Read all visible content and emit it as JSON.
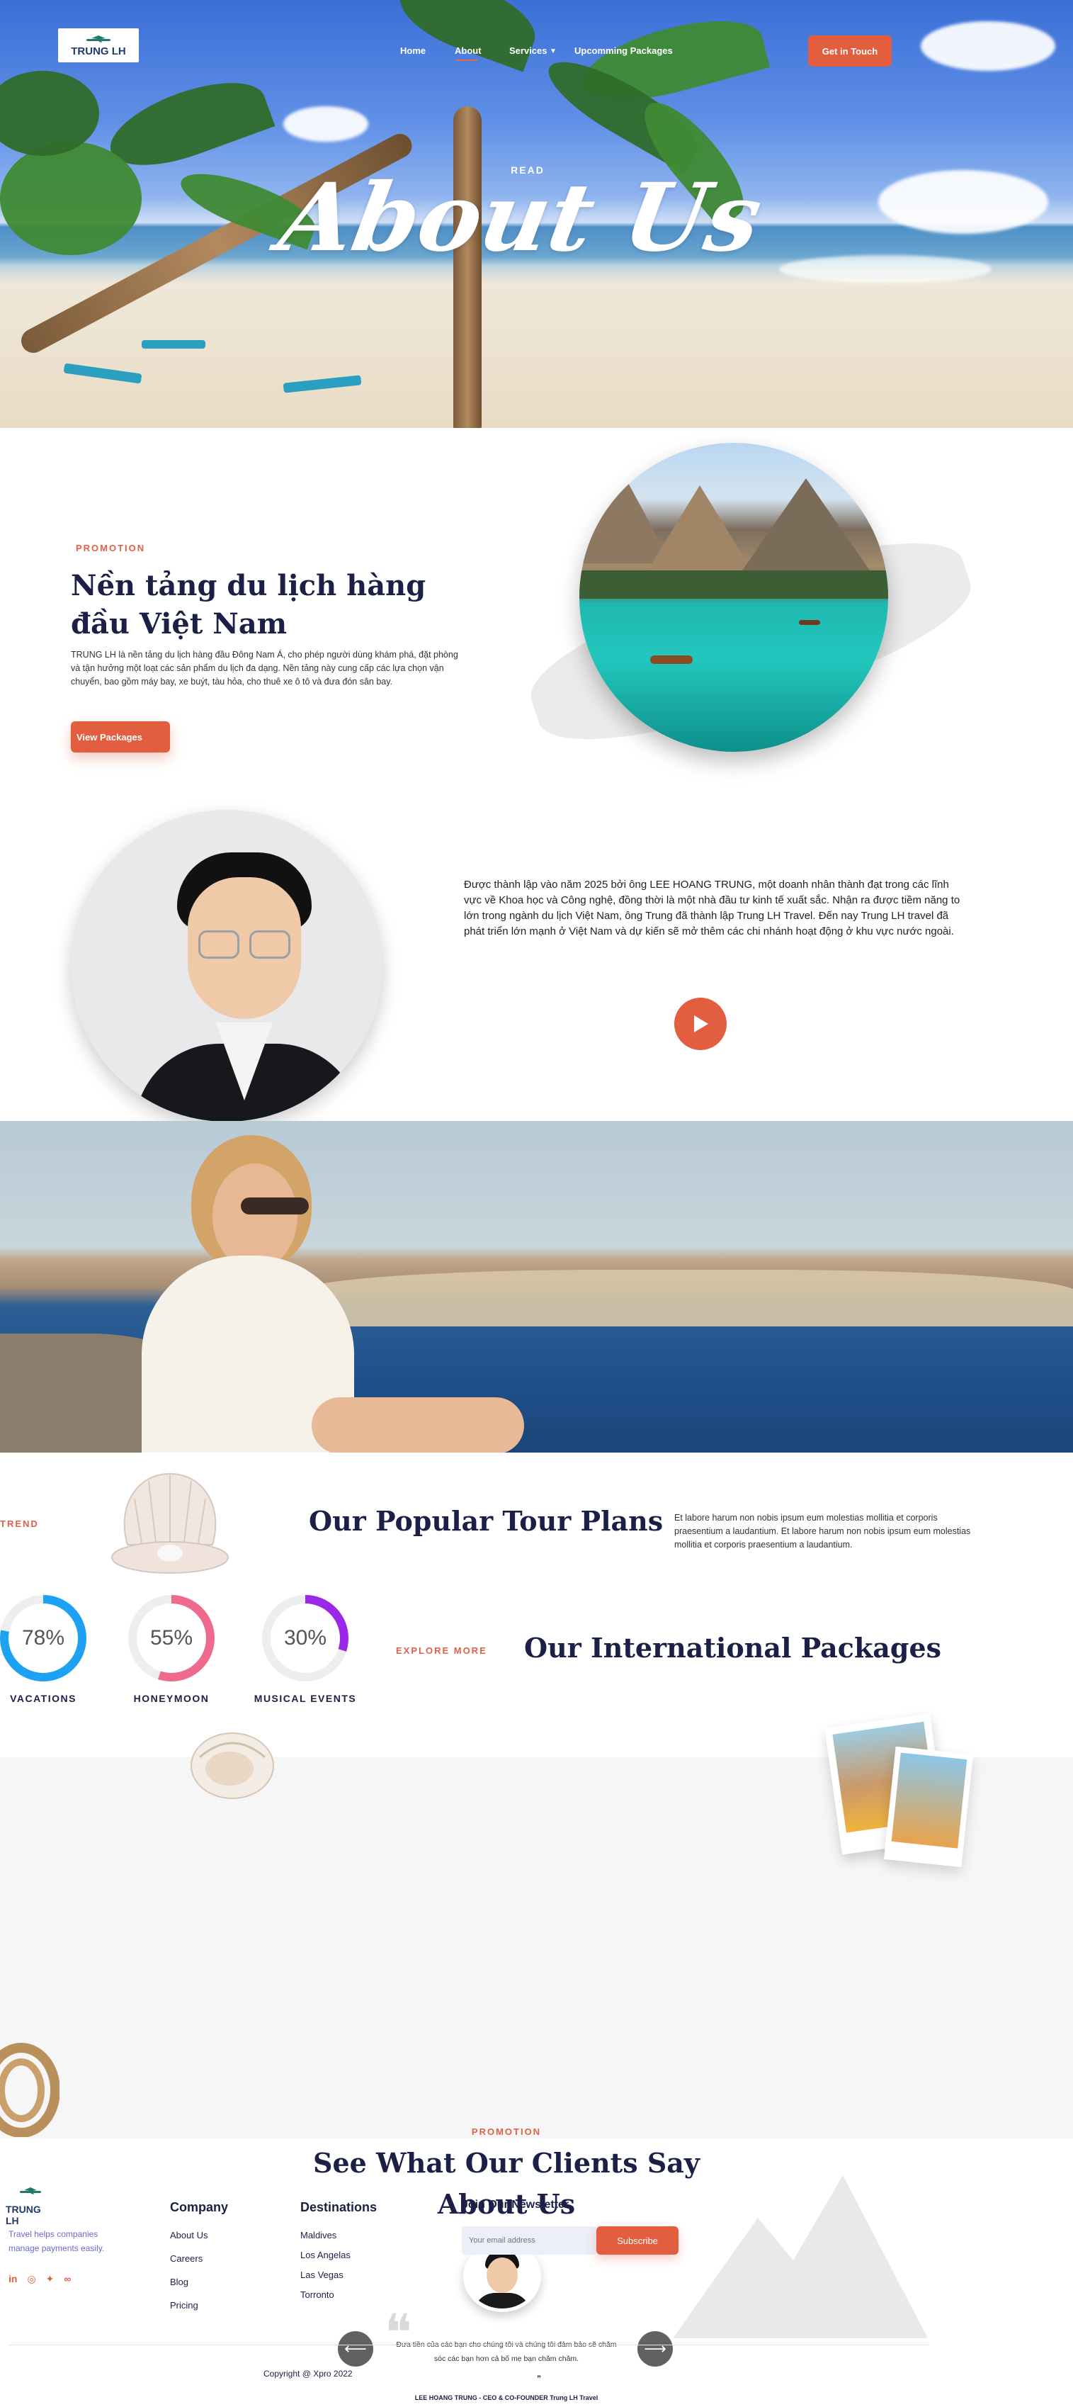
{
  "brand": {
    "name": "TRUNG LH",
    "accent": "#e35d3f",
    "navy": "#1c2046"
  },
  "nav": {
    "items": [
      "Home",
      "About",
      "Services",
      "Upcomming Packages"
    ],
    "active": "About",
    "cta": "Get in Touch"
  },
  "hero": {
    "eyebrow": "READ",
    "title": "About Us"
  },
  "promotion": {
    "eyebrow": "PROMOTION",
    "title_line1": "Nền tảng du lịch hàng",
    "title_line2": "đầu Việt Nam",
    "body": "TRUNG LH là nền tảng du lịch hàng đầu Đông Nam Á, cho phép người dùng khám phá, đặt phòng và tận hưởng một loạt các sản phẩm du lịch đa dạng. Nền tảng này cung cấp các lựa chọn vận chuyển, bao gồm máy bay, xe buýt, tàu hỏa, cho thuê xe ô tô và đưa đón sân bay.",
    "button": "View Packages"
  },
  "founder": {
    "text": "Được thành lập vào năm 2025 bởi ông LEE HOANG TRUNG, một doanh nhân thành đạt trong các lĩnh vực về Khoa học và Công nghệ, đồng thời là một nhà đầu tư kinh tế xuất sắc. Nhận ra được tiềm năng to lớn trong ngành du lịch Việt Nam, ông Trung đã thành lập Trung LH Travel. Đến nay Trung LH travel đã phát triển lớn mạnh ở Việt Nam và dự kiến sẽ mở thêm các chi nhánh hoạt động ở khu vực nước ngoài."
  },
  "tours": {
    "eyebrow": "TREND",
    "title": "Our Popular Tour Plans",
    "body": "Et labore harum non nobis ipsum eum molestias mollitia et corporis praesentium a laudantium. Et labore harum non nobis ipsum eum molestias mollitia et corporis praesentium a laudantium.",
    "stats": [
      {
        "label": "VACATIONS",
        "percent": 78,
        "display": "78%",
        "color": "#1da1f2"
      },
      {
        "label": "HONEYMOON",
        "percent": 55,
        "display": "55%",
        "color": "#f06a8e"
      },
      {
        "label": "MUSICAL EVENTS",
        "percent": 30,
        "display": "30%",
        "color": "#9b27e8"
      }
    ],
    "explore_eyebrow": "EXPLORE MORE",
    "explore_title": "Our International Packages"
  },
  "testimonials": {
    "eyebrow": "PROMOTION",
    "title_line1": "See What Our Clients Say",
    "title_line2": "About Us",
    "quote": "Đưa tiền của các bạn cho chúng tôi và chúng tôi đảm bảo sẽ chăm sóc các bạn hơn cả bố mẹ bạn chăm chăm.",
    "author": "LEE HOANG TRUNG - CEO  & CO-FOUNDER Trung LH Travel"
  },
  "footer": {
    "brand": "TRUNG LH",
    "tagline": "Travel helps companies manage payments easily.",
    "company": {
      "title": "Company",
      "links": [
        "About Us",
        "Careers",
        "Blog",
        "Pricing"
      ]
    },
    "destinations": {
      "title": "Destinations",
      "links": [
        "Maldives",
        "Los Angelas",
        "Las Vegas",
        "Torronto"
      ]
    },
    "newsletter": {
      "title": "Join Our Newsletter",
      "placeholder": "Your email address",
      "button": "Subscribe"
    },
    "copyright": "Copyright @ Xpro 2022"
  }
}
